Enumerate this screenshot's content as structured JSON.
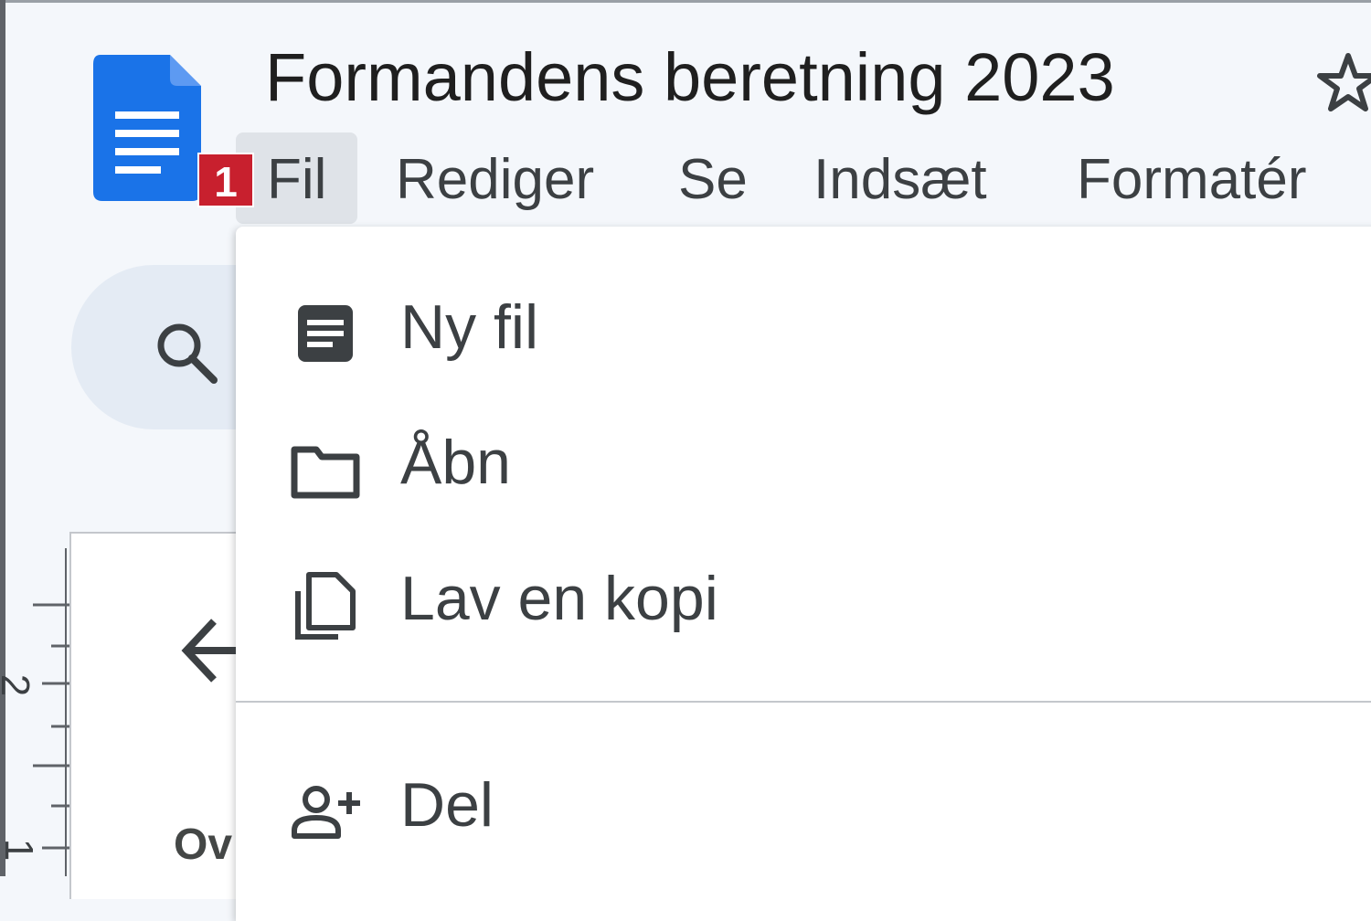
{
  "doc": {
    "title": "Formandens beretning 2023"
  },
  "menubar": {
    "items": [
      {
        "label": "Fil",
        "active": true
      },
      {
        "label": "Rediger"
      },
      {
        "label": "Se"
      },
      {
        "label": "Indsæt"
      },
      {
        "label": "Formatér"
      }
    ]
  },
  "annotation": {
    "badge": "1",
    "color": "#c8202e"
  },
  "file_menu": {
    "items": [
      {
        "label": "Ny fil",
        "icon": "document-icon"
      },
      {
        "label": "Åbn",
        "icon": "folder-icon"
      },
      {
        "label": "Lav en kopi",
        "icon": "copy-icon"
      },
      {
        "label": "Del",
        "icon": "person-add-icon"
      }
    ]
  },
  "ruler": {
    "labels": [
      "2",
      "1"
    ]
  },
  "outline": {
    "partial_label": "Ov"
  },
  "colors": {
    "docs_blue": "#1a73e8",
    "menu_active_bg": "#dfe3e8",
    "background": "#f4f7fb"
  }
}
